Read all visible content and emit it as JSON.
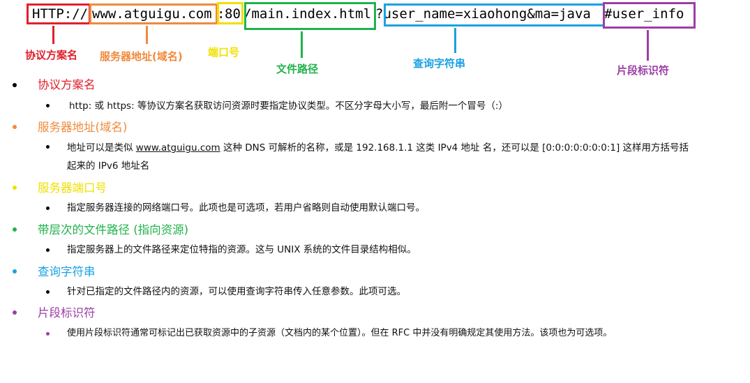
{
  "colors": {
    "protocol": "#e0202c",
    "server": "#f08a3c",
    "port": "#f0e000",
    "path": "#21b24b",
    "query": "#1ba1e2",
    "fragment": "#9b3ea5"
  },
  "url": {
    "protocol": "HTTP://",
    "server": "www.atguigu.com",
    "colon": ":",
    "port": "80",
    "path": "/main.index.html",
    "query": "?user_name=xiaohong&ma=java",
    "fragment": "#user_info"
  },
  "labels": {
    "protocol": "协议方案名",
    "server": "服务器地址(域名)",
    "port": "端口号",
    "path": "文件路径",
    "query": "查询字符串",
    "fragment": "片段标识符"
  },
  "list": [
    {
      "title": "协议方案名",
      "desc": "http: 或 https: 等协议方案名获取访问资源时要指定协议类型。不区分字母大小写，最后附一个冒号（:）"
    },
    {
      "title": "服务器地址(域名)",
      "desc_pre": "地址可以是类似 ",
      "desc_link": "www.atguigu.com",
      "desc_post": " 这种 DNS 可解析的名称，或是 192.168.1.1 这类 IPv4 地址 名，还可以是 [0:0:0:0:0:0:0:1] 这样用方括号括",
      "desc_line2": "起来的 IPv6 地址名"
    },
    {
      "title": "服务器端口号",
      "desc": "指定服务器连接的网络端口号。此项也是可选项，若用户省略则自动使用默认端口号。"
    },
    {
      "title": "带层次的文件路径 (指向资源)",
      "desc": "指定服务器上的文件路径来定位特指的资源。这与 UNIX 系统的文件目录结构相似。"
    },
    {
      "title": "查询字符串",
      "desc": "针对已指定的文件路径内的资源，可以使用查询字符串传入任意参数。此项可选。"
    },
    {
      "title": "片段标识符",
      "desc": "使用片段标识符通常可标记出已获取资源中的子资源（文档内的某个位置）。但在 RFC 中并没有明确规定其使用方法。该项也为可选项。"
    }
  ]
}
